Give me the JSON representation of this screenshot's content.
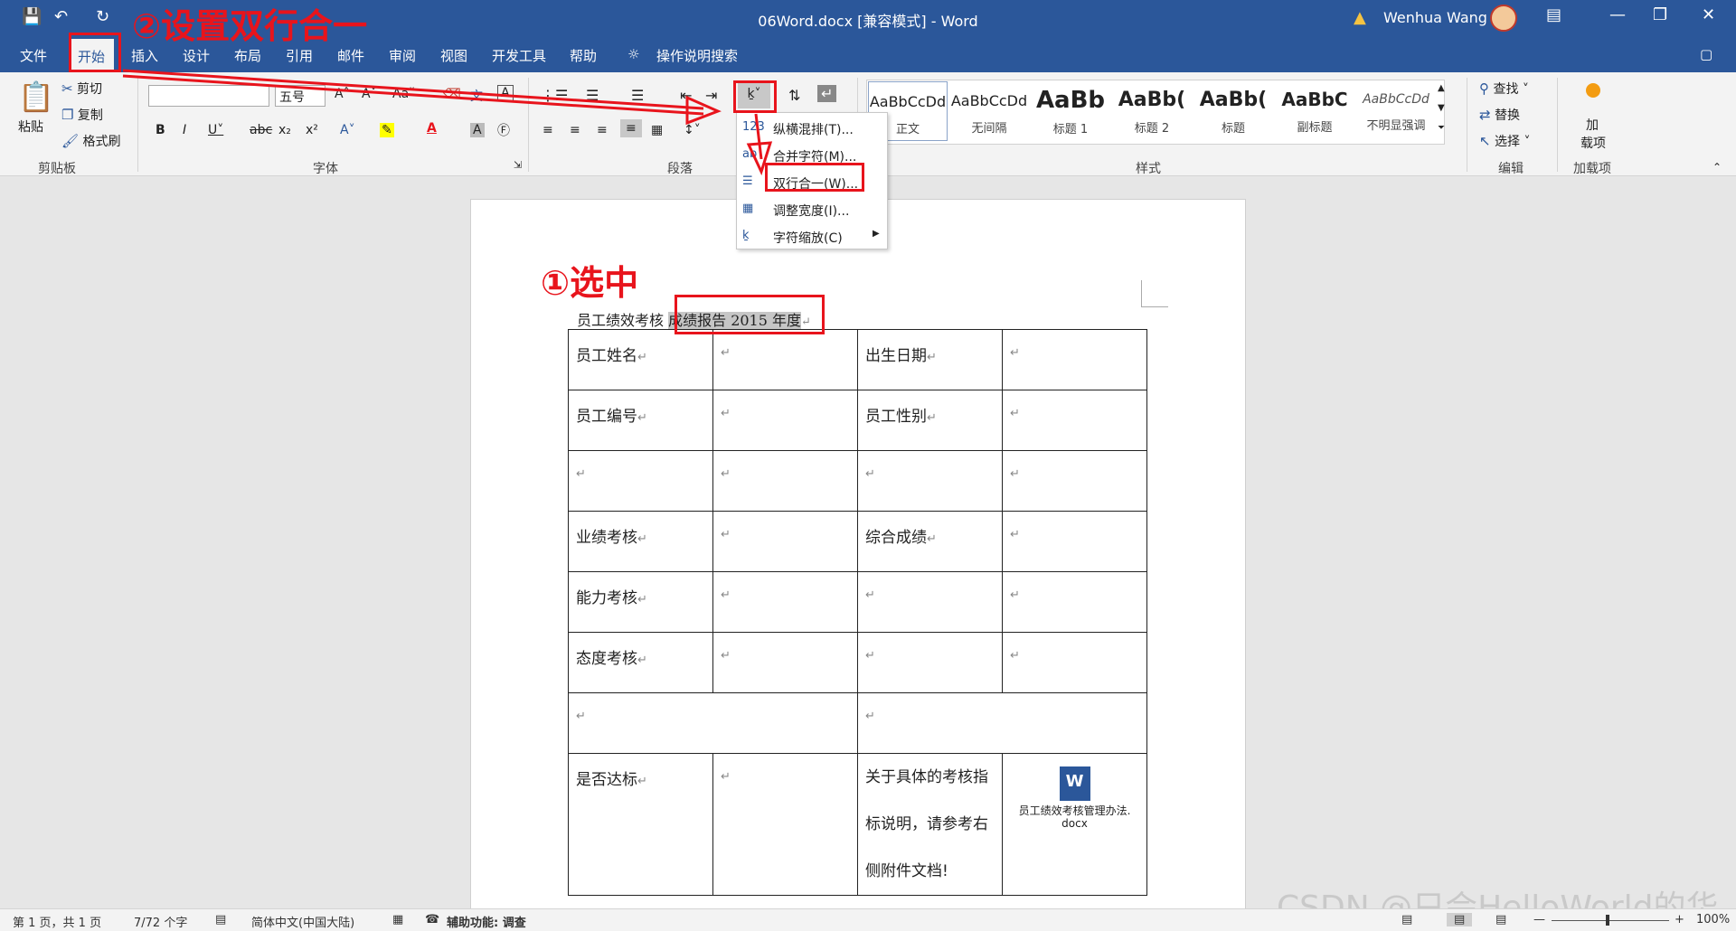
{
  "titlebar": {
    "title": "06Word.docx [兼容模式] - Word",
    "user": "Wenhua Wang",
    "save_icon": "save-icon",
    "undo_icon": "undo-icon",
    "redo_icon": "redo-icon"
  },
  "menu": {
    "tabs": [
      "文件",
      "开始",
      "插入",
      "设计",
      "布局",
      "引用",
      "邮件",
      "审阅",
      "视图",
      "开发工具",
      "帮助"
    ],
    "search": "操作说明搜索"
  },
  "ribbon": {
    "clipboard": {
      "paste": "粘贴",
      "cut": "剪切",
      "copy": "复制",
      "format_painter": "格式刷",
      "label": "剪贴板"
    },
    "font": {
      "font_name": "",
      "font_size": "五号",
      "label": "字体"
    },
    "paragraph": {
      "label": "段落"
    },
    "styles": {
      "items": [
        {
          "preview": "AaBbCcDd",
          "name": "正文"
        },
        {
          "preview": "AaBbCcDd",
          "name": "无间隔"
        },
        {
          "preview": "AaBb",
          "name": "标题 1"
        },
        {
          "preview": "AaBb(",
          "name": "标题 2"
        },
        {
          "preview": "AaBb(",
          "name": "标题"
        },
        {
          "preview": "AaBbC",
          "name": "副标题"
        },
        {
          "preview": "AaBbCcDd",
          "name": "不明显强调"
        }
      ],
      "label": "样式"
    },
    "editing": {
      "find": "查找",
      "replace": "替换",
      "select": "选择",
      "label": "编辑"
    },
    "addins": {
      "line1": "加",
      "line2": "载项",
      "label": "加载项"
    }
  },
  "dropdown": {
    "items": [
      "纵横混排(T)...",
      "合并字符(M)...",
      "双行合一(W)...",
      "调整宽度(I)...",
      "字符缩放(C)"
    ]
  },
  "annotations": {
    "step1": "①选中",
    "step2": "②设置双行合一"
  },
  "document": {
    "line_prefix": "员工绩效考核",
    "line_selected": "成绩报告 2015 年度",
    "table": [
      [
        "员工姓名",
        "",
        "出生日期",
        ""
      ],
      [
        "员工编号",
        "",
        "员工性别",
        ""
      ],
      [
        "",
        "",
        "",
        ""
      ],
      [
        "业绩考核",
        "",
        "综合成绩",
        ""
      ],
      [
        "能力考核",
        "",
        "",
        ""
      ],
      [
        "态度考核",
        "",
        "",
        ""
      ]
    ],
    "merged_row": [
      "",
      ""
    ],
    "last_row": {
      "c1": "是否达标",
      "c3_l1": "关于具体的考核指",
      "c3_l2": "标说明，请参考右",
      "c3_l3": "侧附件文档!",
      "attachment": "员工绩效考核管理办法. docx"
    }
  },
  "statusbar": {
    "page": "第 1 页，共 1 页",
    "words": "7/72 个字",
    "lang": "简体中文(中国大陆)",
    "accessibility": "辅助功能: 调查",
    "zoom": "100%"
  },
  "watermark": "CSDN @只会HelloWorld的华娃"
}
